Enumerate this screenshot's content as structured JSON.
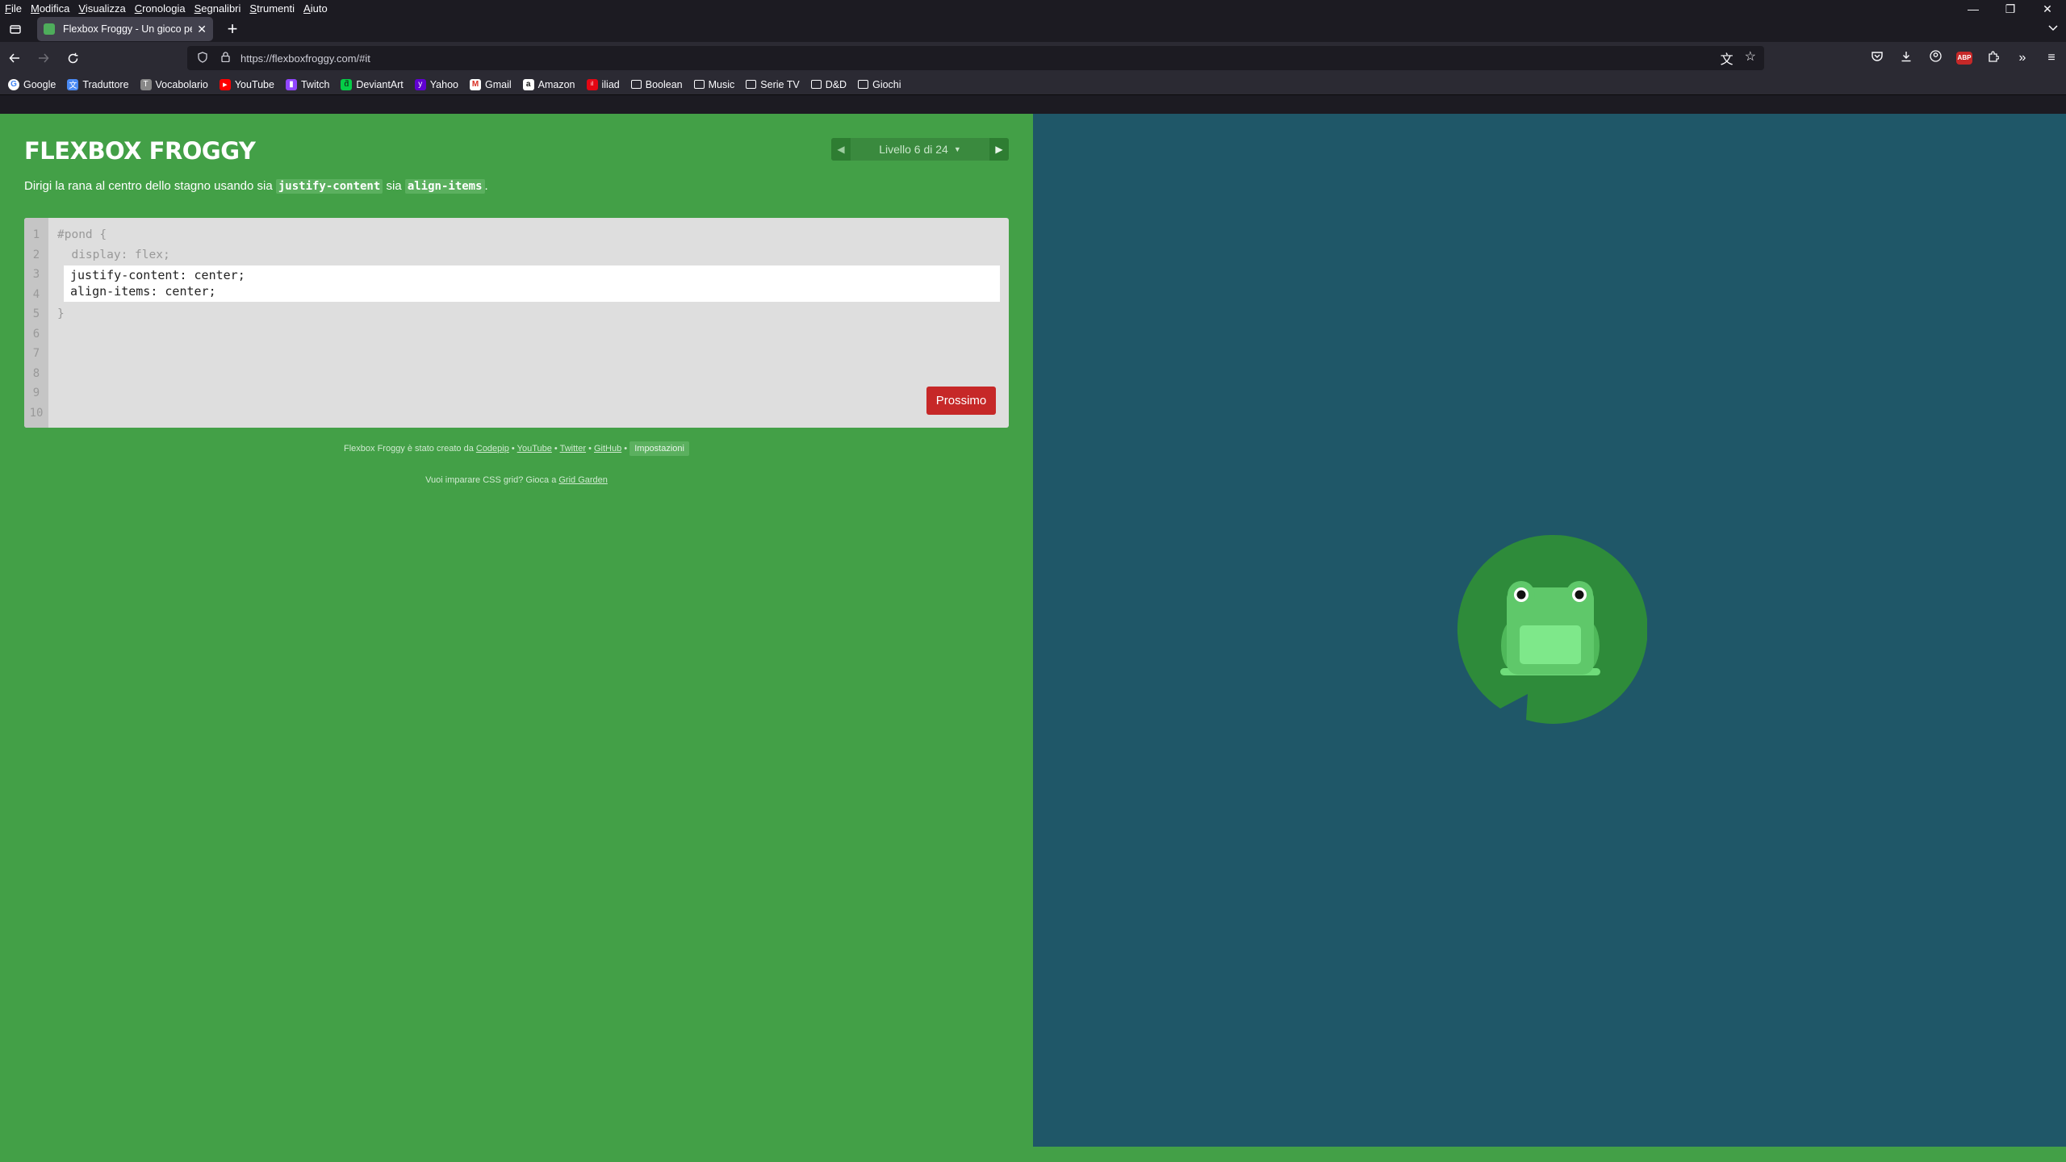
{
  "menu": [
    "File",
    "Modifica",
    "Visualizza",
    "Cronologia",
    "Segnalibri",
    "Strumenti",
    "Aiuto"
  ],
  "window": {
    "minimize": "—",
    "restore": "❐",
    "close": "✕"
  },
  "tab": {
    "title": "Flexbox Froggy - Un gioco per",
    "close": "✕",
    "new_tab": "+"
  },
  "url": {
    "address": "https://flexboxfroggy.com/#it"
  },
  "bookmarks": [
    {
      "label": "Google",
      "icon": "google-icon",
      "glyph": "G"
    },
    {
      "label": "Traduttore",
      "icon": "translate-icon",
      "glyph": "文"
    },
    {
      "label": "Vocabolario",
      "icon": "vocabolario-icon",
      "glyph": "T"
    },
    {
      "label": "YouTube",
      "icon": "youtube-icon",
      "glyph": "▶"
    },
    {
      "label": "Twitch",
      "icon": "twitch-icon",
      "glyph": "▮"
    },
    {
      "label": "DeviantArt",
      "icon": "deviantart-icon",
      "glyph": "ƌ"
    },
    {
      "label": "Yahoo",
      "icon": "yahoo-icon",
      "glyph": "y"
    },
    {
      "label": "Gmail",
      "icon": "gmail-icon",
      "glyph": "M"
    },
    {
      "label": "Amazon",
      "icon": "amazon-icon",
      "glyph": "a"
    },
    {
      "label": "iliad",
      "icon": "iliad-icon",
      "glyph": "il"
    },
    {
      "label": "Boolean",
      "icon": "folder-icon",
      "glyph": ""
    },
    {
      "label": "Music",
      "icon": "folder-icon",
      "glyph": ""
    },
    {
      "label": "Serie TV",
      "icon": "folder-icon",
      "glyph": ""
    },
    {
      "label": "D&D",
      "icon": "folder-icon",
      "glyph": ""
    },
    {
      "label": "Giochi",
      "icon": "folder-icon",
      "glyph": ""
    }
  ],
  "game": {
    "logo": "FLEXBOX FROGGY",
    "level_label": "Livello 6 di 24",
    "prev_arrow": "◀",
    "next_arrow": "▶",
    "caret": "▼",
    "instruction_prefix": "Dirigi la rana al centro dello stagno usando sia ",
    "instruction_code1": "justify-content",
    "instruction_mid": " sia ",
    "instruction_code2": "align-items",
    "instruction_suffix": ".",
    "line_numbers": [
      "1",
      "2",
      "3",
      "4",
      "5",
      "6",
      "7",
      "8",
      "9",
      "10"
    ],
    "code_before": [
      "#pond {",
      "  display: flex;"
    ],
    "code_input": [
      "justify-content: center;",
      "align-items: center;"
    ],
    "code_after": [
      "}"
    ],
    "next_button": "Prossimo",
    "credits_prefix": "Flexbox Froggy è stato creato da ",
    "credits_links": [
      "Codepip",
      "YouTube",
      "Twitter",
      "GitHub"
    ],
    "separator": " • ",
    "settings": "Impostazioni",
    "grid_prefix": "Vuoi imparare CSS grid? Gioca a ",
    "grid_link": "Grid Garden"
  },
  "colors": {
    "board_green": "#43a047",
    "pond_blue": "#1f5768",
    "lilypad": "#2e8b3a",
    "frog": "#5fc86a",
    "next_button": "#c62828"
  }
}
